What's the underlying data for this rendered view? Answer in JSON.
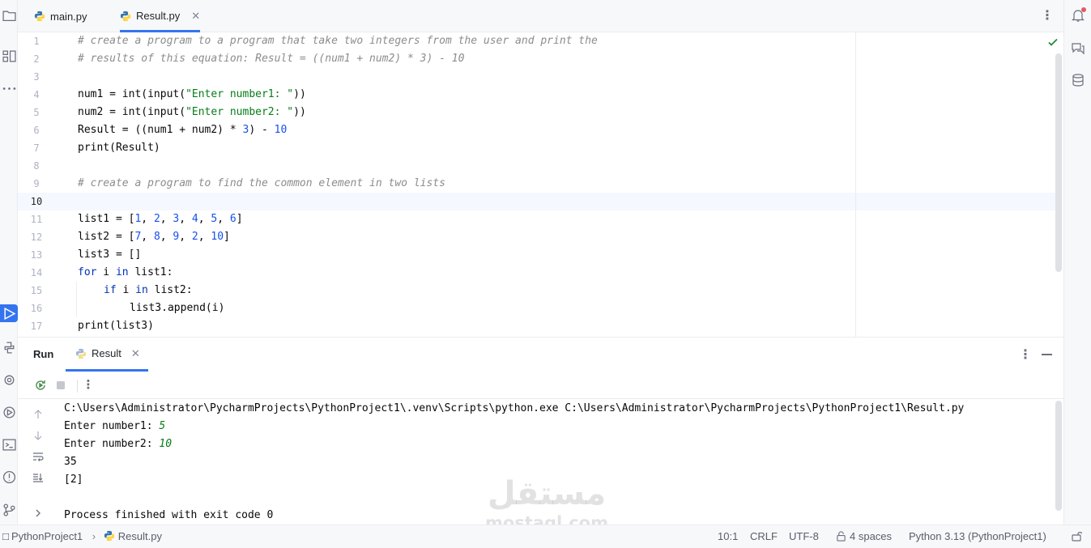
{
  "tabs": [
    {
      "label": "main.py",
      "icon": "python-file-icon",
      "active": false
    },
    {
      "label": "Result.py",
      "icon": "python-file-icon",
      "active": true
    }
  ],
  "editor": {
    "lines": [
      {
        "num": "1"
      },
      {
        "num": "2"
      },
      {
        "num": "3"
      },
      {
        "num": "4"
      },
      {
        "num": "5"
      },
      {
        "num": "6"
      },
      {
        "num": "7"
      },
      {
        "num": "8"
      },
      {
        "num": "9"
      },
      {
        "num": "10"
      },
      {
        "num": "11"
      },
      {
        "num": "12"
      },
      {
        "num": "13"
      },
      {
        "num": "14"
      },
      {
        "num": "15"
      },
      {
        "num": "16"
      },
      {
        "num": "17"
      }
    ],
    "code": {
      "l1": "# create a program to a program that take two integers from the user and print the",
      "l2": "# results of this equation: Result = ((num1 + num2) * 3) - 10",
      "l4a": "num1 = int(input(",
      "l4s": "\"Enter number1: \"",
      "l4b": "))",
      "l5a": "num2 = int(input(",
      "l5s": "\"Enter number2: \"",
      "l5b": "))",
      "l6a": "Result = ((num1 + num2) * ",
      "l6n1": "3",
      "l6b": ") - ",
      "l6n2": "10",
      "l7": "print(Result)",
      "l9": "# create a program to find the common element in two lists",
      "l11a": "list1 = [",
      "l11n1": "1",
      "l11n2": "2",
      "l11n3": "3",
      "l11n4": "4",
      "l11n5": "5",
      "l11n6": "6",
      "l11b": "]",
      "l12a": "list2 = [",
      "l12n1": "7",
      "l12n2": "8",
      "l12n3": "9",
      "l12n4": "2",
      "l12n5": "10",
      "l12b": "]",
      "l13": "list3 = []",
      "l14kw1": "for",
      "l14a": " i ",
      "l14kw2": "in",
      "l14b": " list1:",
      "l15kw1": "if",
      "l15a": " i ",
      "l15kw2": "in",
      "l15b": " list2:",
      "l16": "list3.append(i)",
      "l17": "print(list3)"
    },
    "current_line": "10"
  },
  "run_panel": {
    "title": "Run",
    "tab_label": "Result",
    "console": {
      "command": "C:\\Users\\Administrator\\PycharmProjects\\PythonProject1\\.venv\\Scripts\\python.exe C:\\Users\\Administrator\\PycharmProjects\\PythonProject1\\Result.py",
      "prompt1": "Enter number1: ",
      "input1": "5",
      "prompt2": "Enter number2: ",
      "input2": "10",
      "output1": "35",
      "output2": "[2]",
      "exit_message": "Process finished with exit code 0"
    }
  },
  "watermark": {
    "arabic": "مستقل",
    "latin": "mostaql.com"
  },
  "status_bar": {
    "project": "PythonProject1",
    "file": "Result.py",
    "position": "10:1",
    "line_ending": "CRLF",
    "encoding": "UTF-8",
    "indent": "4 spaces",
    "interpreter": "Python 3.13 (PythonProject1)"
  },
  "colors": {
    "accent": "#3574f0",
    "comment": "#8c8c8c",
    "string": "#067d17",
    "number": "#1750eb",
    "keyword": "#0033b3"
  }
}
